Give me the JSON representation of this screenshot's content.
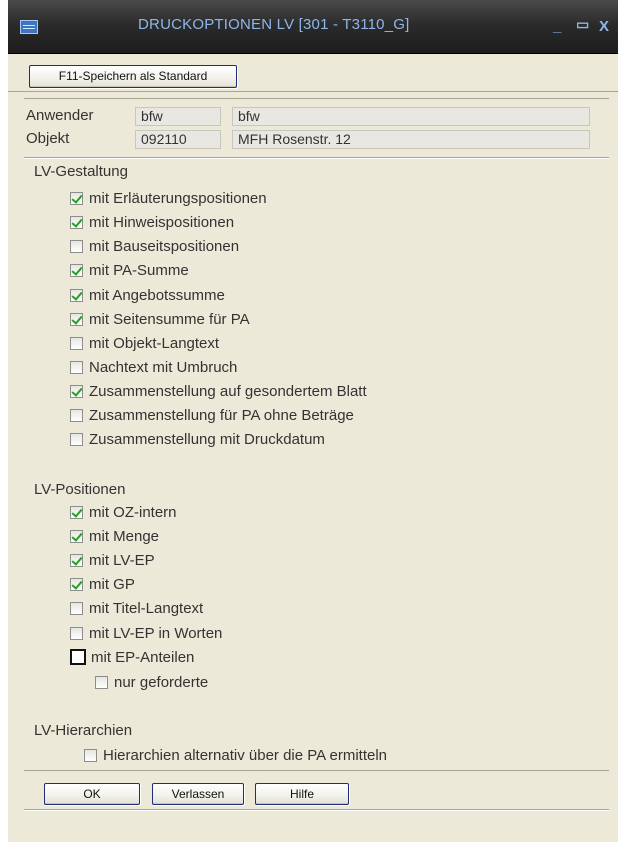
{
  "window": {
    "title": "DRUCKOPTIONEN LV  [301 - T3110_G]",
    "controls": {
      "minimize": "_",
      "maximize": "▭",
      "close": "X"
    }
  },
  "toolbar": {
    "save_default_label": "F11-Speichern als Standard"
  },
  "info": {
    "user_label": "Anwender",
    "user_code": "bfw",
    "user_name": "bfw",
    "object_label": "Objekt",
    "object_code": "092110",
    "object_name": "MFH Rosenstr. 12"
  },
  "sections": {
    "gestaltung": {
      "title": "LV-Gestaltung",
      "options": [
        {
          "label": "mit Erläuterungspositionen",
          "checked": true
        },
        {
          "label": "mit Hinweispositionen",
          "checked": true
        },
        {
          "label": "mit Bauseitspositionen",
          "checked": false
        },
        {
          "label": "mit PA-Summe",
          "checked": true
        },
        {
          "label": "mit Angebotssumme",
          "checked": true
        },
        {
          "label": "mit Seitensumme für PA",
          "checked": true
        },
        {
          "label": "mit Objekt-Langtext",
          "checked": false
        },
        {
          "label": "Nachtext mit Umbruch",
          "checked": false
        },
        {
          "label": "Zusammenstellung auf gesondertem Blatt",
          "checked": true
        },
        {
          "label": "Zusammenstellung für PA ohne Beträge",
          "checked": false
        },
        {
          "label": "Zusammenstellung mit Druckdatum",
          "checked": false
        }
      ]
    },
    "positionen": {
      "title": "LV-Positionen",
      "options": [
        {
          "label": "mit OZ-intern",
          "checked": true
        },
        {
          "label": "mit Menge",
          "checked": true
        },
        {
          "label": "mit LV-EP",
          "checked": true
        },
        {
          "label": "mit GP",
          "checked": true
        },
        {
          "label": "mit Titel-Langtext",
          "checked": false
        },
        {
          "label": "mit LV-EP in Worten",
          "checked": false
        },
        {
          "label": "mit EP-Anteilen",
          "checked": false
        },
        {
          "label": "nur geforderte",
          "checked": false
        }
      ]
    },
    "hierarchien": {
      "title": "LV-Hierarchien",
      "options": [
        {
          "label": "Hierarchien alternativ über die PA ermitteln",
          "checked": false
        }
      ]
    }
  },
  "footer": {
    "ok_label": "OK",
    "leave_label": "Verlassen",
    "help_label": "Hilfe"
  }
}
